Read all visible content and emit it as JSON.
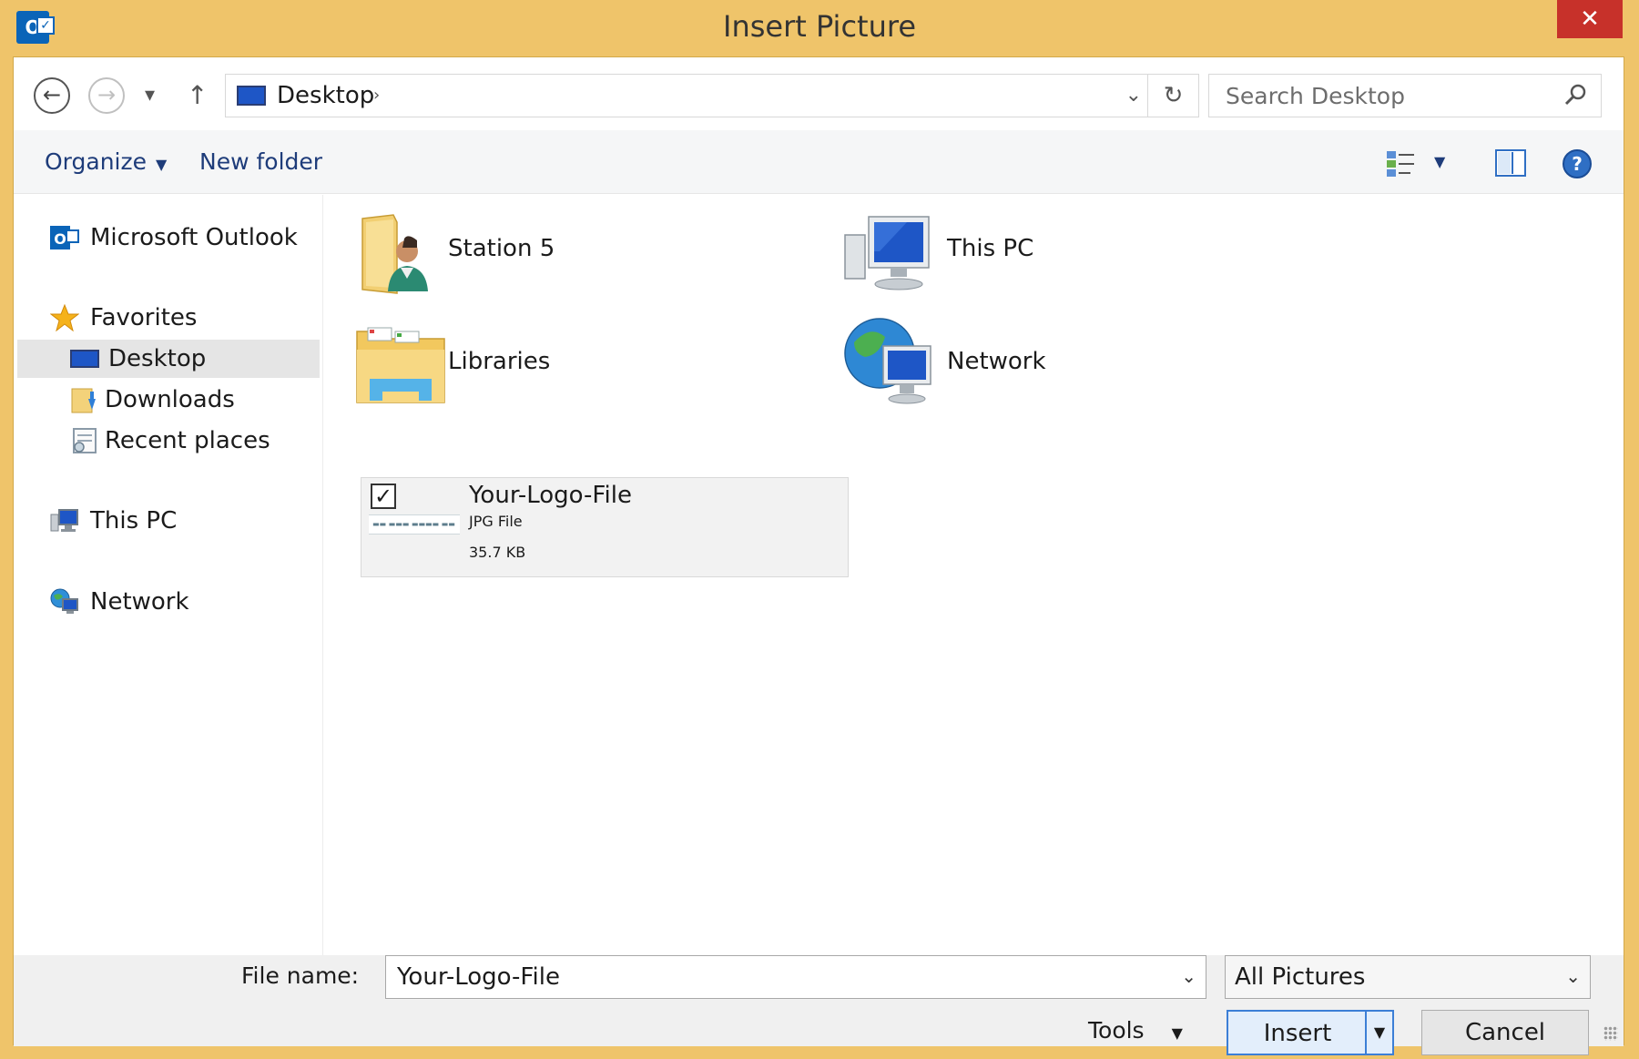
{
  "window": {
    "title": "Insert Picture",
    "app_icon_letter": "O",
    "close_glyph": "✕",
    "accent_color": "#efc46a",
    "close_color": "#c7312a"
  },
  "navbar": {
    "back_glyph": "←",
    "forward_glyph": "→",
    "recent_glyph": "▾",
    "up_glyph": "↑",
    "address_crumb": "Desktop",
    "address_crumb_arrow": "›",
    "address_drop_glyph": "⌄",
    "refresh_glyph": "↻",
    "search_placeholder": "Search Desktop"
  },
  "toolbar": {
    "organize_label": "Organize",
    "new_folder_label": "New folder",
    "caret": "▼"
  },
  "sidebar": {
    "outlook": "Microsoft Outlook",
    "favorites": "Favorites",
    "favorites_items": [
      {
        "label": "Desktop",
        "selected": true
      },
      {
        "label": "Downloads",
        "selected": false
      },
      {
        "label": "Recent places",
        "selected": false
      }
    ],
    "this_pc": "This PC",
    "network": "Network"
  },
  "content": {
    "items": [
      {
        "name": "Station 5",
        "icon": "user-folder-icon"
      },
      {
        "name": "This PC",
        "icon": "computer-icon"
      },
      {
        "name": "Libraries",
        "icon": "libraries-folder-icon"
      },
      {
        "name": "Network",
        "icon": "network-globe-icon"
      }
    ],
    "selected_file": {
      "name": "Your-Logo-File",
      "type": "JPG File",
      "size": "35.7 KB",
      "checked": true,
      "check_glyph": "✓"
    }
  },
  "bottom": {
    "file_name_label": "File name:",
    "file_name_value": "Your-Logo-File",
    "file_type_value": "All Pictures",
    "tools_label": "Tools",
    "insert_label": "Insert",
    "cancel_label": "Cancel",
    "dropdown_glyph": "⌄",
    "caret": "▼"
  }
}
